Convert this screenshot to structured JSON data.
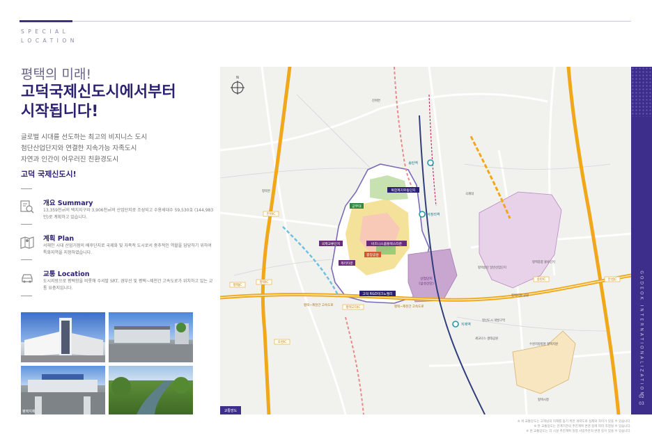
{
  "header": {
    "section_en_line1": "SPECIAL",
    "section_en_line2": "LOCATION"
  },
  "headline": {
    "line1": "평택의 미래!",
    "line2": "고덕국제신도시에서부터",
    "line3": "시작됩니다!"
  },
  "intro": {
    "line1": "글로벌 시대를 선도하는 최고의 비지니스 도시",
    "line2": "첨단산업단지와 연결한 지속가능 자족도시",
    "line3": "자연과 인간이 어우러진 친환경도시",
    "strong": "고덕 국제신도시!"
  },
  "info": [
    {
      "icon": "report-search-icon",
      "title": "개요 Summary",
      "desc": "13,359천㎡의 택지지구와 3,906천㎡의 산업단지로 조성되고 수용세대수 59,530호 (144,983인)로 계획하고 있습니다."
    },
    {
      "icon": "map-icon",
      "title": "계획 Plan",
      "desc": "서해안 시대 산업거점의 배후단지로 국제화 및 자족적 도시로서 중추적인 역할을 담당하기 위하여 특화지역을 지정하였습니다."
    },
    {
      "icon": "car-icon",
      "title": "교통 Location",
      "desc": "도시지방으로 평택항을 비롯해 수서발 SRT, 경부선 및 평택~제천간 고속도로가 위치하고 있는 교통 요충지입니다."
    }
  ],
  "photos": [
    {
      "label": ""
    },
    {
      "label": ""
    },
    {
      "label": "평택지제"
    },
    {
      "label": ""
    }
  ],
  "map": {
    "corner_tag": "교통망도",
    "north_label": "N",
    "zones": {
      "complex_support": "복합제지우동단지",
      "military": "군부대",
      "international_edu": "국제교류단지",
      "business_complex": "비즈니스콤플렉스타운",
      "central_park": "중앙공원",
      "lake_town": "캐리타운",
      "industrial": "산업단지",
      "industrial_sub": "(삼성산단)",
      "rnd_valley": "고덕 R&D테크노밸리"
    },
    "stations": {
      "songtan": "송탄역",
      "seojeongri": "서정리역",
      "jije": "지제역"
    },
    "ic": {
      "ic1": "진위IC",
      "ic2": "평택JC",
      "ic3": "평택IC",
      "ic4": "오성IC",
      "ic5": "송탄IC",
      "ic6": "안성JC",
      "ic7": "평택고덕IC",
      "ic8": "서평택IC"
    },
    "roads": {
      "r1": "평택~제천간 고속도로",
      "r2": "평택~제천간 고속도로",
      "r3": "경부선철도",
      "r4": "서해안고속도로"
    },
    "places": {
      "p1": "평택송탄 일반산업단지",
      "p2": "평택종합 물류단지",
      "p3": "평택지원 공원",
      "p4": "평택시청",
      "p5": "세교나스 생태공원",
      "p6": "수원지방법원 평택지원",
      "p7": "영신도시 개발구역",
      "p8": "국제대",
      "p9": "진위면",
      "p10": "청북면",
      "p11": "평택시청"
    }
  },
  "side": {
    "vertical_label": "GODEOK INTERNATIONALIZATION",
    "page_top": "02",
    "page_bottom": "03"
  },
  "footnotes": {
    "line1": "※ 위 교통망도는 고객님의 이해를 돕기 위한 개략도로 실제와 차이가 있을 수 있습니다.",
    "line2": "※ 본 교통망도는 관계기관의 추진계획 변경 등에 따라 조정될 수 있습니다.",
    "line3": "※ 본 교통망도는 각 시설 추진계획 일정 사업주관처 변경 등이 있을 수 있습니다."
  },
  "colors": {
    "brand": "#3c2e8a",
    "expressway": "#f0a81a",
    "rail": "#2f3e7a",
    "industrial_zone": "#c9a6d0",
    "logistic_zone": "#e8d2ea",
    "park_zone": "#f6e2b8"
  }
}
